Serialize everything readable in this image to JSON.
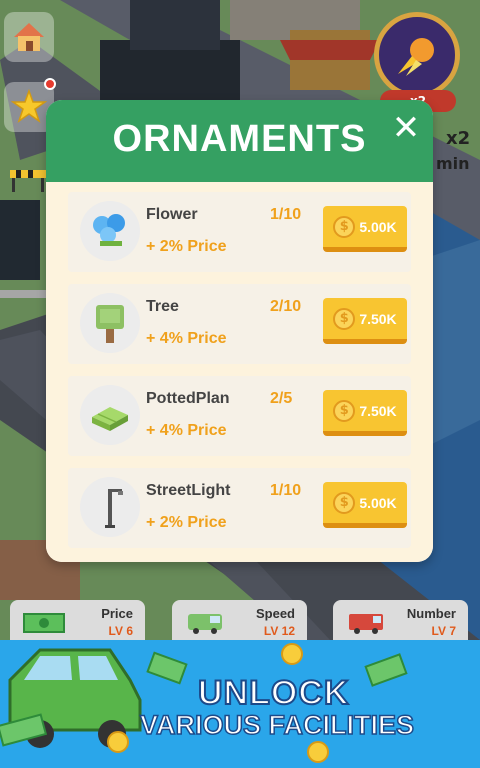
{
  "dialog": {
    "title": "ORNAMENTS",
    "close_icon": "close-icon",
    "items": [
      {
        "name": "Flower",
        "bonus": "+ 2% Price",
        "level": "1/10",
        "price": "5.00K",
        "icon": "flower-icon"
      },
      {
        "name": "Tree",
        "bonus": "+ 4% Price",
        "level": "2/10",
        "price": "7.50K",
        "icon": "tree-icon"
      },
      {
        "name": "PottedPlan",
        "bonus": "+ 4% Price",
        "level": "2/5",
        "price": "7.50K",
        "icon": "hedge-icon"
      },
      {
        "name": "StreetLight",
        "bonus": "+ 2% Price",
        "level": "1/10",
        "price": "5.00K",
        "icon": "streetlight-icon"
      }
    ]
  },
  "hud": {
    "boost_label": "x2",
    "boost_time": "min",
    "boost_tag": "x2"
  },
  "upgrades": [
    {
      "label": "Price",
      "level": "LV 6",
      "icon": "money-icon"
    },
    {
      "label": "Speed",
      "level": "LV 12",
      "icon": "van-icon"
    },
    {
      "label": "Number",
      "level": "LV 7",
      "icon": "truck-icon"
    }
  ],
  "banner": {
    "line1": "UNLOCK",
    "line2": "VARIOUS FACILITIES"
  },
  "colors": {
    "header_green": "#35a062",
    "accent_orange": "#f0a11c",
    "button_yellow": "#f8c531",
    "banner_blue": "#2aa6ea"
  }
}
